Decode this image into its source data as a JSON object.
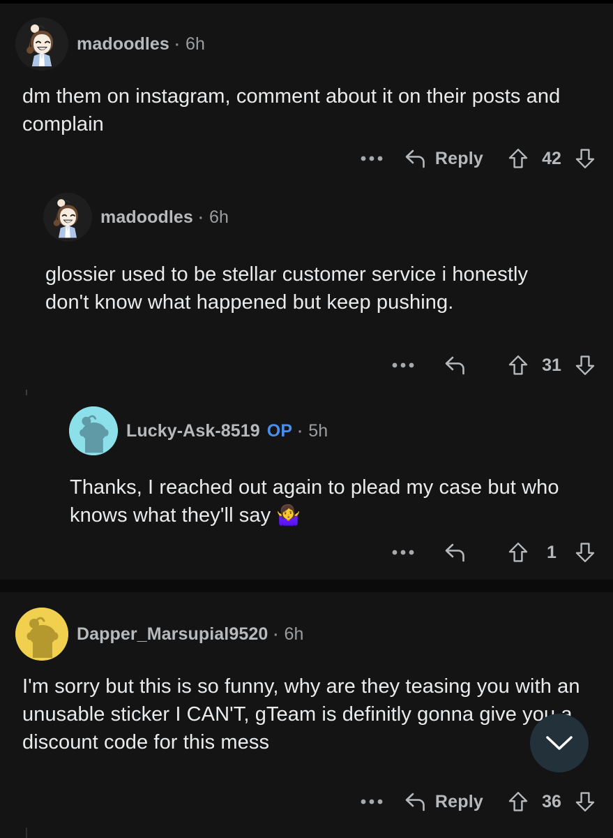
{
  "app": {
    "name": "reddit-comment-thread",
    "theme": "dark",
    "background_color": "#141414",
    "body_text_color": "#e9ebed",
    "username_color": "#b7babd",
    "op_badge_color": "#4a8fee",
    "thread_line_color": "#3c3f41"
  },
  "comments": [
    {
      "id": "c1",
      "depth": 1,
      "author": "madoodles",
      "op": false,
      "separator": "·",
      "age": "6h",
      "body": "dm them on instagram, comment about it on their posts and complain",
      "avatar": {
        "name": "madoodles-avatar",
        "style": "snoo-girl-brown-hair-blue-jacket",
        "bg": "#1e1e1e",
        "hair": "#6b4a33",
        "skin": "#f6ece0",
        "jacket": "#aec6e8"
      },
      "actions": {
        "more_label": "•••",
        "more_icon": "overflow-dots-icon",
        "reply_label": "Reply",
        "reply_icon": "reply-arrow-icon",
        "show_reply_label": true,
        "upvote_icon": "upvote-arrow-icon",
        "downvote_icon": "downvote-arrow-icon",
        "score": "42"
      }
    },
    {
      "id": "c2",
      "depth": 2,
      "author": "madoodles",
      "op": false,
      "separator": "·",
      "age": "6h",
      "body": "glossier used to be stellar customer service i honestly don't know what happened but keep pushing.",
      "avatar": {
        "name": "madoodles-avatar",
        "style": "snoo-girl-brown-hair-blue-jacket",
        "bg": "#1e1e1e",
        "hair": "#6b4a33",
        "skin": "#f6ece0",
        "jacket": "#aec6e8"
      },
      "actions": {
        "more_label": "•••",
        "more_icon": "overflow-dots-icon",
        "reply_label": "",
        "reply_icon": "reply-arrow-icon",
        "show_reply_label": false,
        "upvote_icon": "upvote-arrow-icon",
        "downvote_icon": "downvote-arrow-icon",
        "score": "31"
      }
    },
    {
      "id": "c3",
      "depth": 3,
      "author": "Lucky-Ask-8519",
      "op": true,
      "op_label": "OP",
      "separator": "·",
      "age": "5h",
      "body": "Thanks, I reached out again to plead my case but who knows what they'll say ",
      "body_emoji": "🤷‍♀️",
      "avatar": {
        "name": "lucky-ask-8519-avatar",
        "style": "snoo-silhouette",
        "bg": "#8ce0ea",
        "figure": "#5f9aa6"
      },
      "actions": {
        "more_label": "•••",
        "more_icon": "overflow-dots-icon",
        "reply_label": "",
        "reply_icon": "reply-arrow-icon",
        "show_reply_label": false,
        "upvote_icon": "upvote-arrow-icon",
        "downvote_icon": "downvote-arrow-icon",
        "score": "1"
      }
    },
    {
      "id": "c4",
      "depth": 1,
      "author": "Dapper_Marsupial9520",
      "op": false,
      "separator": "·",
      "age": "6h",
      "body": "I'm sorry but this is so funny, why are they teasing you with an unusable sticker I CAN'T, gTeam is definitly gonna give you a discount code for this mess",
      "avatar": {
        "name": "dapper-marsupial9520-avatar",
        "style": "snoo-silhouette",
        "bg": "#f0d04e",
        "figure": "#b5992f"
      },
      "actions": {
        "more_label": "•••",
        "more_icon": "overflow-dots-icon",
        "reply_label": "Reply",
        "reply_icon": "reply-arrow-icon",
        "show_reply_label": true,
        "upvote_icon": "upvote-arrow-icon",
        "downvote_icon": "downvote-arrow-icon",
        "score": "36"
      }
    }
  ],
  "floating_button": {
    "name": "scroll-to-next-comment-button",
    "icon": "chevron-down-icon",
    "background": "#23313a",
    "icon_color": "#ffffff"
  }
}
